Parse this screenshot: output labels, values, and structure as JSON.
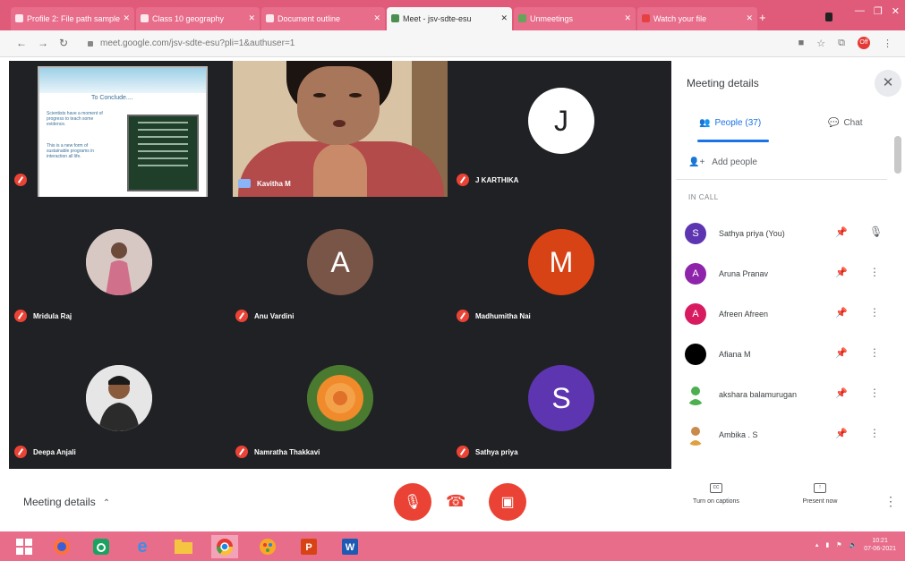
{
  "browser": {
    "tabs": [
      {
        "label": "Profile 2: File path sample",
        "active": false
      },
      {
        "label": "Class 10 geography",
        "active": false
      },
      {
        "label": "Document outline",
        "active": false
      },
      {
        "label": "Meet - jsv-sdte-esu",
        "active": true
      },
      {
        "label": "Unmeetings",
        "active": false
      },
      {
        "label": "Watch your file",
        "active": false
      }
    ],
    "url": "meet.google.com/jsv-sdte-esu?pli=1&authuser=1",
    "extension_badge": "Off"
  },
  "stage": {
    "slide": {
      "title": "To Conclude....",
      "text_1": "Scientists have a moment of progress to teach some evidence.",
      "text_2": "This is a new form of sustainable programs in interaction all life."
    },
    "tiles": [
      {
        "name": "",
        "initial": "",
        "color": ""
      },
      {
        "name": "Kavitha M",
        "initial": "",
        "color": ""
      },
      {
        "name": "J KARTHIKA",
        "initial": "J",
        "color": "#ffffff"
      },
      {
        "name": "Mridula Raj",
        "initial": "",
        "color": ""
      },
      {
        "name": "Anu Vardini",
        "initial": "A",
        "color": "#795548"
      },
      {
        "name": "Madhumitha Nai",
        "initial": "M",
        "color": "#d84315"
      },
      {
        "name": "Deepa Anjali",
        "initial": "",
        "color": ""
      },
      {
        "name": "Namratha Thakkavi",
        "initial": "",
        "color": ""
      },
      {
        "name": "Sathya priya",
        "initial": "S",
        "color": "#5e35b1"
      }
    ]
  },
  "panel": {
    "title": "Meeting details",
    "tab_people": "People (37)",
    "tab_chat": "Chat",
    "add_people": "Add people",
    "section_label": "IN CALL",
    "participants": [
      {
        "name": "Sathya priya (You)",
        "initial": "S",
        "color": "#5e35b1"
      },
      {
        "name": "Aruna Pranav",
        "initial": "A",
        "color": "#8e24aa"
      },
      {
        "name": "Afreen Afreen",
        "initial": "A",
        "color": "#d81b60"
      },
      {
        "name": "Afiana M",
        "initial": "",
        "color": "#000000"
      },
      {
        "name": "akshara balamurugan",
        "initial": "",
        "color": "#ffffff"
      },
      {
        "name": "Ambika . S",
        "initial": "",
        "color": "#ffffff"
      }
    ]
  },
  "controls": {
    "meeting_details": "Meeting details",
    "captions": "Turn on captions",
    "present": "Present now"
  },
  "taskbar": {
    "time": "10:21",
    "date": "07-06-2021"
  }
}
